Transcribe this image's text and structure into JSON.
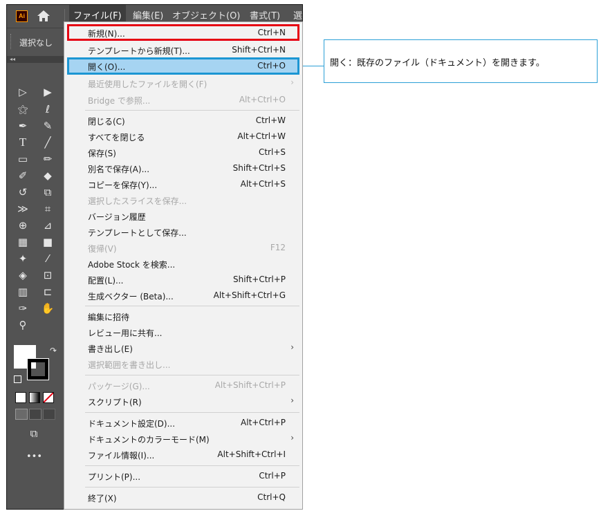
{
  "menubar": {
    "app_logo": "Ai",
    "items": [
      "ファイル(F)",
      "編集(E)",
      "オブジェクト(O)",
      "書式(T)",
      "選"
    ]
  },
  "selection": {
    "label": "選択なし"
  },
  "file_menu": {
    "items": [
      {
        "label": "新規(N)...",
        "shortcut": "Ctrl+N"
      },
      {
        "label": "テンプレートから新規(T)...",
        "shortcut": "Shift+Ctrl+N"
      },
      {
        "label": "開く(O)...",
        "shortcut": "Ctrl+O"
      },
      {
        "label": "最近使用したファイルを開く(F)",
        "shortcut": "",
        "arrow": "›"
      },
      {
        "label": "Bridge で参照...",
        "shortcut": "Alt+Ctrl+O"
      },
      {
        "label": "閉じる(C)",
        "shortcut": "Ctrl+W"
      },
      {
        "label": "すべてを閉じる",
        "shortcut": "Alt+Ctrl+W"
      },
      {
        "label": "保存(S)",
        "shortcut": "Ctrl+S"
      },
      {
        "label": "別名で保存(A)...",
        "shortcut": "Shift+Ctrl+S"
      },
      {
        "label": "コピーを保存(Y)...",
        "shortcut": "Alt+Ctrl+S"
      },
      {
        "label": "選択したスライスを保存...",
        "shortcut": ""
      },
      {
        "label": "バージョン履歴",
        "shortcut": ""
      },
      {
        "label": "テンプレートとして保存...",
        "shortcut": ""
      },
      {
        "label": "復帰(V)",
        "shortcut": "F12"
      },
      {
        "label": "Adobe Stock を検索...",
        "shortcut": ""
      },
      {
        "label": "配置(L)...",
        "shortcut": "Shift+Ctrl+P"
      },
      {
        "label": "生成ベクター (Beta)...",
        "shortcut": "Alt+Shift+Ctrl+G"
      },
      {
        "label": "編集に招待",
        "shortcut": ""
      },
      {
        "label": "レビュー用に共有...",
        "shortcut": ""
      },
      {
        "label": "書き出し(E)",
        "shortcut": "",
        "arrow": "›"
      },
      {
        "label": "選択範囲を書き出し...",
        "shortcut": ""
      },
      {
        "label": "パッケージ(G)...",
        "shortcut": "Alt+Shift+Ctrl+P"
      },
      {
        "label": "スクリプト(R)",
        "shortcut": "",
        "arrow": "›"
      },
      {
        "label": "ドキュメント設定(D)...",
        "shortcut": "Alt+Ctrl+P"
      },
      {
        "label": "ドキュメントのカラーモード(M)",
        "shortcut": "",
        "arrow": "›"
      },
      {
        "label": "ファイル情報(I)...",
        "shortcut": "Alt+Shift+Ctrl+I"
      },
      {
        "label": "プリント(P)...",
        "shortcut": "Ctrl+P"
      },
      {
        "label": "終了(X)",
        "shortcut": "Ctrl+Q"
      }
    ]
  },
  "callout": {
    "text": "開く：既存のファイル（ドキュメント）を開きます。"
  },
  "colors": {
    "accent_red": "#e60012",
    "accent_blue": "#1c96d3",
    "highlight": "#a6d4f2"
  }
}
